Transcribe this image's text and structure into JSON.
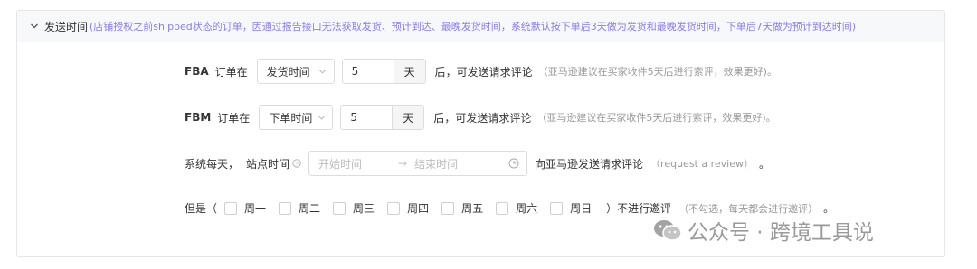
{
  "header": {
    "title": "发送时间",
    "note": "(店铺授权之前shipped状态的订单，因通过报告接口无法获取发货、预计到达、最晚发货时间，系统默认按下单后3天做为发货和最晚发货时间，下单后7天做为预计到达时间)"
  },
  "fba": {
    "prefix": "FBA",
    "text1": "订单在",
    "select": "发货时间",
    "days": "5",
    "unit": "天",
    "text2": "后，可发送请求评论",
    "hint": "（亚马逊建议在买家收件5天后进行索评，效果更好)。"
  },
  "fbm": {
    "prefix": "FBM",
    "text1": "订单在",
    "select": "下单时间",
    "days": "5",
    "unit": "天",
    "text2": "后，可发送请求评论",
    "hint": "（亚马逊建议在买家收件5天后进行索评，效果更好)。"
  },
  "daily": {
    "text1": "系统每天，",
    "site_time": "站点时间",
    "start_placeholder": "开始时间",
    "arrow": "→",
    "end_placeholder": "结束时间",
    "text2": "向亚马逊发送请求评论",
    "hint": "（request a review）",
    "end": "。"
  },
  "except": {
    "text1": "但是（",
    "days": [
      "周一",
      "周二",
      "周三",
      "周四",
      "周五",
      "周六",
      "周日"
    ],
    "text2": "）不进行邀评",
    "hint": "（不勾选，每天都会进行邀评）",
    "end": "。"
  },
  "watermark": {
    "text": "公众号 · 跨境工具说",
    "icon": "wechat-icon"
  },
  "colors": {
    "note": "#8a7cf0",
    "border": "#dcdcdc",
    "header_bg": "#f7f8fa"
  }
}
